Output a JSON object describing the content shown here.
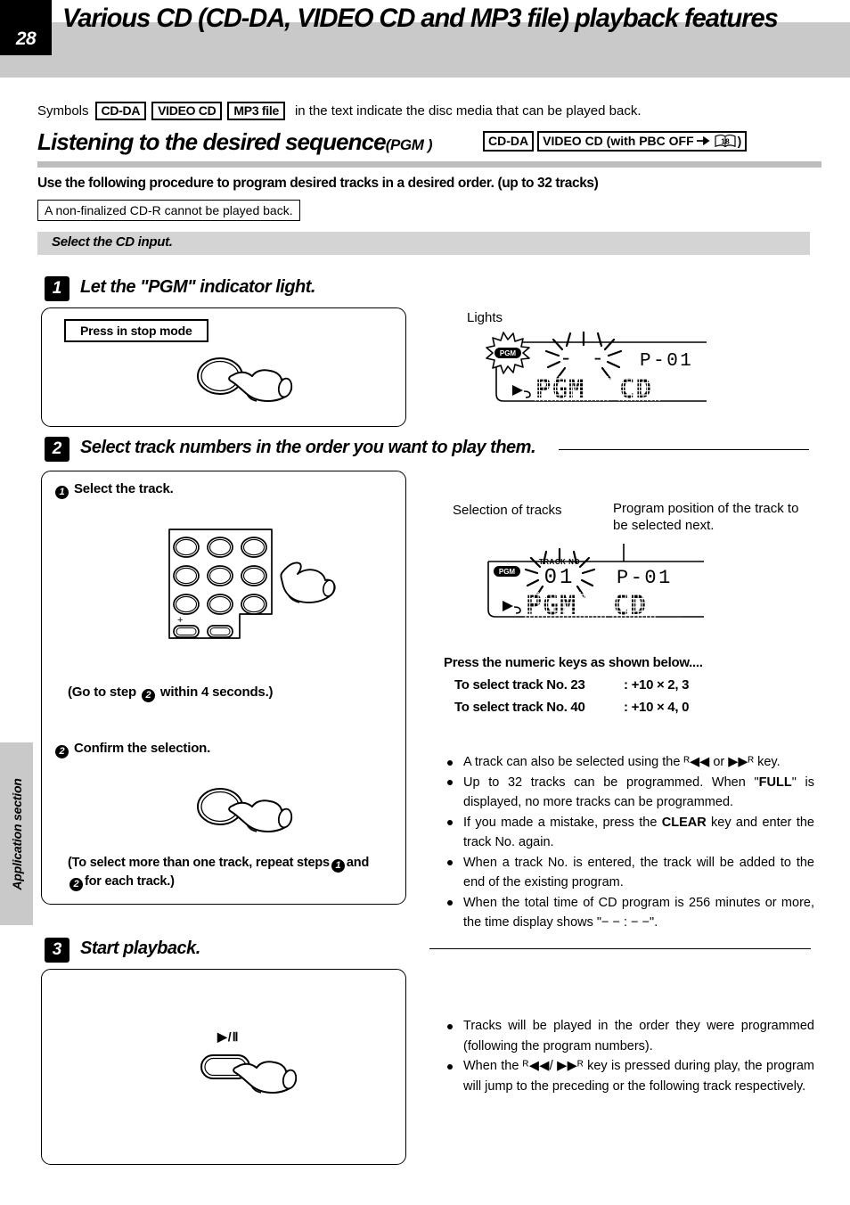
{
  "header": {
    "page_number": "28",
    "title": "Various CD (CD-DA, VIDEO CD and MP3 file) playback features"
  },
  "symbols_line": {
    "pretext": "Symbols",
    "badges": [
      "CD-DA",
      "VIDEO CD",
      "MP3 file"
    ],
    "posttext": "in the text indicate the disc media that can be played back."
  },
  "section": {
    "title": "Listening to the desired sequence",
    "title_suffix": "(PGM )",
    "media_badge_1": "CD-DA",
    "media_badge_2_pre": "VIDEO CD (with PBC OFF",
    "media_badge_2_arrow": "→",
    "media_badge_2_page": "18",
    "media_badge_2_post": ")"
  },
  "intro": {
    "text": "Use the following procedure to program desired tracks in a desired order. (up to 32 tracks)",
    "note": "A non-finalized CD-R cannot be played back.",
    "band": "Select the CD input."
  },
  "steps": [
    {
      "num": "1",
      "label": "Let  the \"PGM\" indicator light.",
      "panel_badge": "Press in stop mode"
    },
    {
      "num": "2",
      "label": "Select track numbers in the order you want to play them.",
      "sub1_num": "1",
      "sub1_label": "Select the track.",
      "sub1_note_pre": "(Go to step",
      "sub1_note_num": "2",
      "sub1_note_post": "within 4 seconds.)",
      "sub2_num": "2",
      "sub2_label": "Confirm the selection.",
      "sub2_note_pre": "(To select more than one track, repeat steps",
      "sub2_note_num1": "1",
      "sub2_note_mid": "and",
      "sub2_note_num2": "2",
      "sub2_note_post": "for each track.)",
      "keypad_plus_label": "+"
    },
    {
      "num": "3",
      "label": "Start playback.",
      "button_symbol": "▶/Ⅱ"
    }
  ],
  "display_1": {
    "caption": "Lights",
    "indicator": "PGM",
    "track_field": "- -",
    "program_field": "P - 01",
    "mode_text": "PGM",
    "source_text": "CD"
  },
  "display_2": {
    "caption_left": "Selection of tracks",
    "caption_right": "Program position of the track to be selected next.",
    "indicator": "PGM",
    "track_label": "TRACK NO",
    "track_field": "01",
    "program_field": "P - 01",
    "mode_text": "PGM",
    "source_text": "CD"
  },
  "numeric_keys": {
    "heading": "Press the numeric keys as shown below....",
    "rows": [
      {
        "left": "To select track No. 23",
        "right": ": +10 × 2, 3"
      },
      {
        "left": "To select track No. 40",
        "right": ": +10 × 4, 0"
      }
    ]
  },
  "notes_step2": [
    "A track can also be selected using the ᴿ◀◀ or ▶▶ᴿ key.",
    "Up to 32 tracks can be programmed. When \"FULL\" is  displayed, no more tracks can be programmed.",
    "If you made a mistake, press the CLEAR key and enter the track No. again.",
    "When a track No. is entered, the track will be added  to the end of the existing program.",
    "When the total time of CD program is 256 minutes or more, the time display shows \"− − : − −\"."
  ],
  "notes_step3": [
    "Tracks will be played in the order they were programmed (following the program numbers).",
    "When the ᴿ◀◀/ ▶▶ᴿ key is pressed during play, the program will jump to the preceding or the following track respectively."
  ],
  "side_tab": {
    "label": "Application section"
  },
  "colors": {
    "header_band": "#c9c9c9",
    "gray_rule": "#bdbdbd",
    "gray_band": "#d4d4d4",
    "ink": "#000000"
  }
}
